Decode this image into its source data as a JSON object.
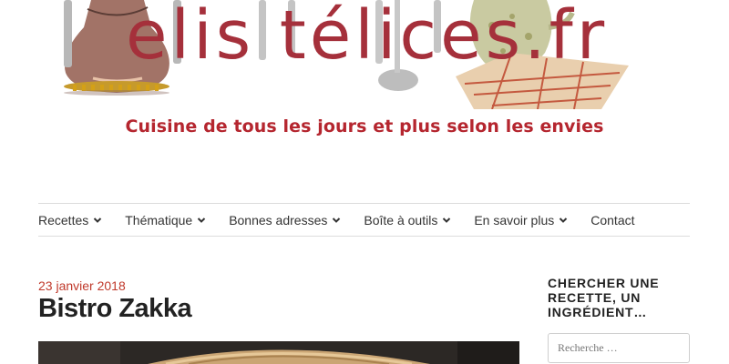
{
  "site": {
    "logo_text": "elis télices.fr",
    "tagline": "Cuisine de tous les jours et plus selon les envies"
  },
  "nav": {
    "items": [
      {
        "label": "Recettes",
        "dropdown": true
      },
      {
        "label": "Thématique",
        "dropdown": true
      },
      {
        "label": "Bonnes adresses",
        "dropdown": true
      },
      {
        "label": "Boîte à outils",
        "dropdown": true
      },
      {
        "label": "En savoir plus",
        "dropdown": true
      },
      {
        "label": "Contact",
        "dropdown": false
      }
    ]
  },
  "post": {
    "date": "23 janvier 2018",
    "title": "Bistro Zakka"
  },
  "sidebar": {
    "widget_title": "Chercher une recette, un ingrédient…",
    "search_placeholder": "Recherche …"
  },
  "colors": {
    "brand": "#b5262f",
    "date": "#c0392b",
    "text": "#333333"
  }
}
